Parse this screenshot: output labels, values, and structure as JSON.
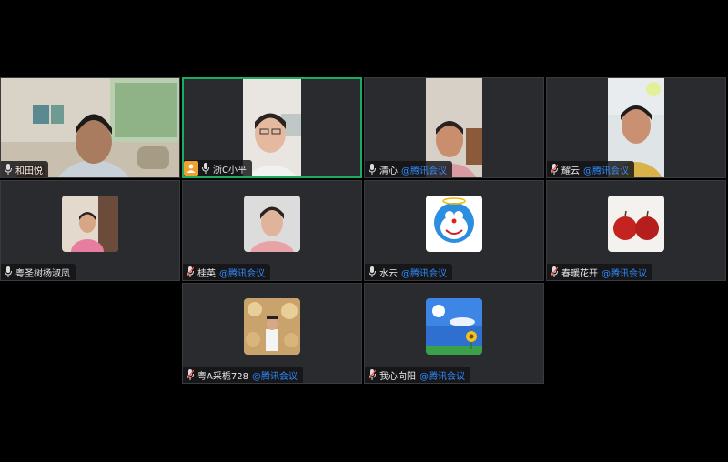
{
  "meeting": {
    "suffix": "@腾讯会议",
    "participants": [
      {
        "name": "和田悦",
        "mic": "on",
        "has_suffix": false
      },
      {
        "name": "浙C小平",
        "mic": "on",
        "has_suffix": false,
        "host": true,
        "active_speaker": true
      },
      {
        "name": "清心",
        "mic": "on",
        "has_suffix": true
      },
      {
        "name": "耀云",
        "mic": "muted",
        "has_suffix": true
      },
      {
        "name": "粤圣树杨淑凤",
        "mic": "on",
        "has_suffix": false
      },
      {
        "name": "桂英",
        "mic": "muted",
        "has_suffix": true
      },
      {
        "name": "水云",
        "mic": "on",
        "has_suffix": true
      },
      {
        "name": "春暖花开",
        "mic": "muted",
        "has_suffix": true
      },
      {
        "name": "粤A采栀728",
        "mic": "muted",
        "has_suffix": true
      },
      {
        "name": "我心向阳",
        "mic": "muted",
        "has_suffix": true
      }
    ]
  }
}
